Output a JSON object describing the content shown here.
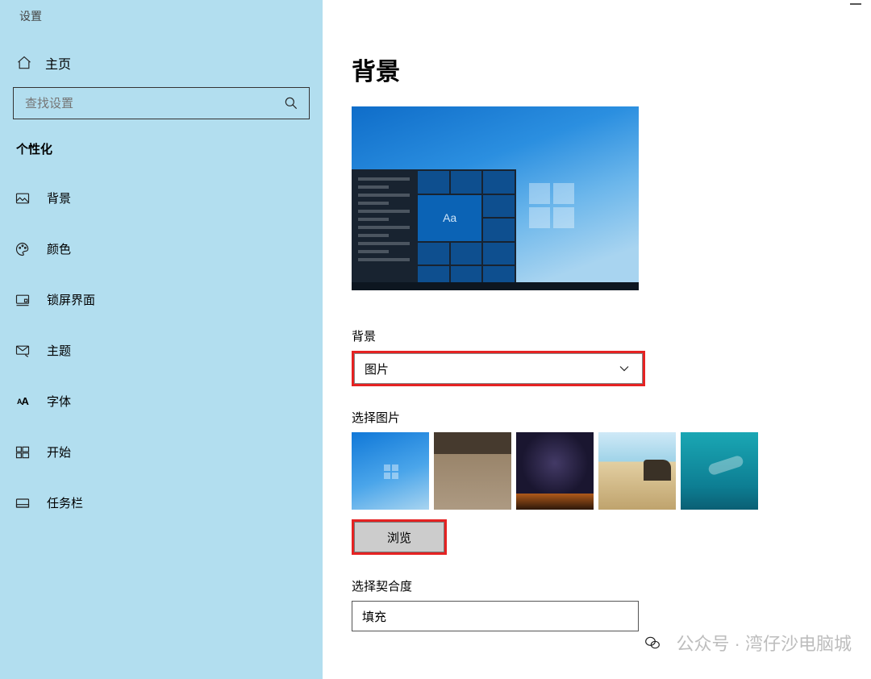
{
  "window": {
    "title": "设置"
  },
  "sidebar": {
    "home": "主页",
    "search_placeholder": "查找设置",
    "section": "个性化",
    "items": [
      {
        "label": "背景"
      },
      {
        "label": "颜色"
      },
      {
        "label": "锁屏界面"
      },
      {
        "label": "主题"
      },
      {
        "label": "字体"
      },
      {
        "label": "开始"
      },
      {
        "label": "任务栏"
      }
    ]
  },
  "main": {
    "heading": "背景",
    "preview_tile_text": "Aa",
    "bg_label": "背景",
    "bg_value": "图片",
    "choose_label": "选择图片",
    "browse": "浏览",
    "fit_label": "选择契合度",
    "fit_value": "填充"
  },
  "watermark": {
    "text": "公众号 · 湾仔沙电脑城"
  }
}
